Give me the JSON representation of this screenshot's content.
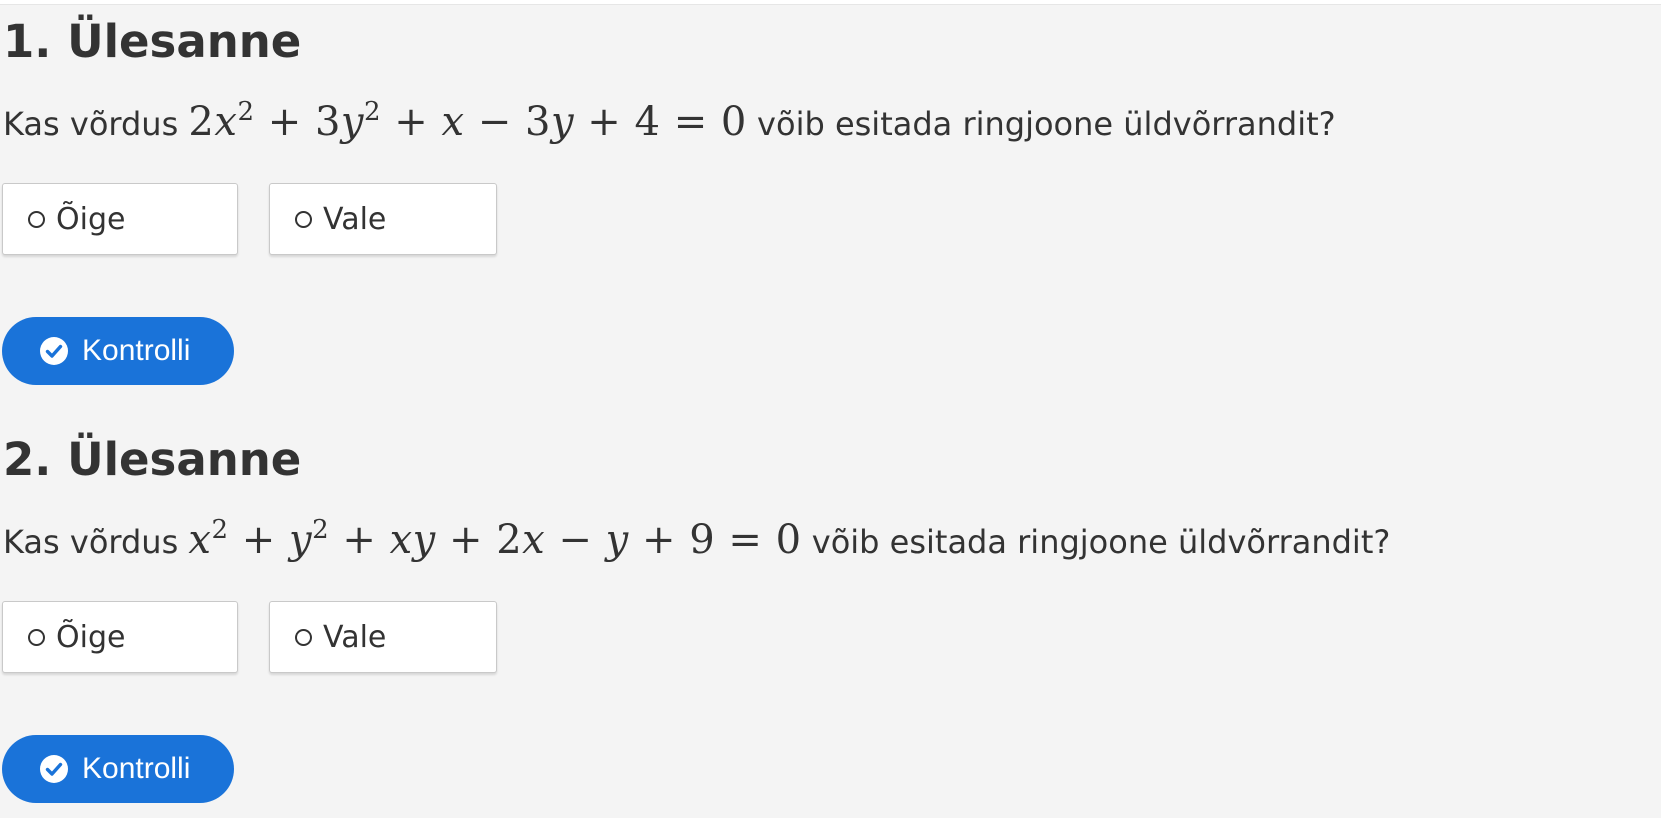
{
  "tasks": [
    {
      "title": "1. Ülesanne",
      "question_prefix": "Kas võrdus",
      "equation": {
        "t1": "2",
        "v1": "x",
        "s1": "2",
        "op1": " + ",
        "t2": "3",
        "v2": "y",
        "s2": "2",
        "op2": " + ",
        "t3": "",
        "v3": "x",
        "op3": " − ",
        "t4": "3",
        "v4": "y",
        "tail": " + 4 = 0"
      },
      "question_suffix": "võib esitada ringjoone üldvõrrandit?",
      "options": [
        "Õige",
        "Vale"
      ],
      "button_label": "Kontrolli"
    },
    {
      "title": "2. Ülesanne",
      "question_prefix": "Kas võrdus",
      "equation": {
        "v1": "x",
        "s1": "2",
        "op1": " + ",
        "v2": "y",
        "s2": "2",
        "op2": " + ",
        "v3": "xy",
        "op3": " + ",
        "t4": "2",
        "v4": "x",
        "op4": " − ",
        "v5": "y",
        "tail": " + 9 = 0"
      },
      "question_suffix": "võib esitada ringjoone üldvõrrandit?",
      "options": [
        "Õige",
        "Vale"
      ],
      "button_label": "Kontrolli"
    }
  ],
  "colors": {
    "page_background": "#f4f4f4",
    "button_background": "#1a73d9",
    "button_text": "#ffffff",
    "text": "#333333"
  },
  "icons": {
    "option": "radio-circle-icon",
    "button": "check-circle-icon"
  }
}
